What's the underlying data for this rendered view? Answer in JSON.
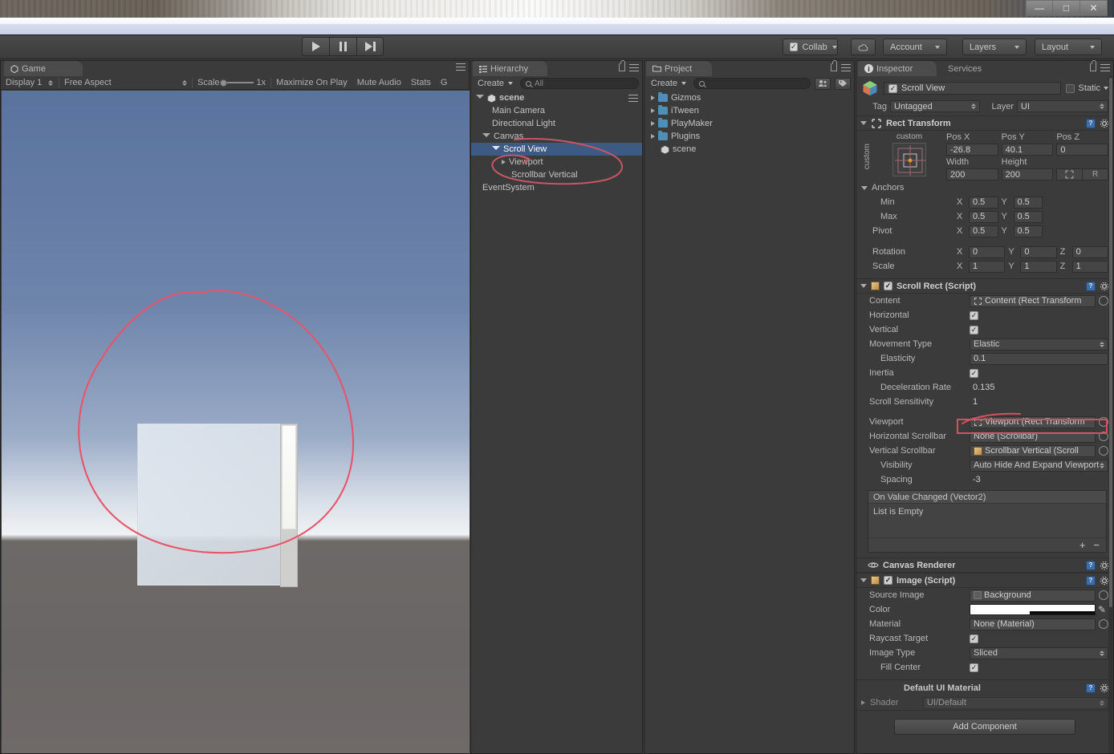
{
  "window": {
    "controls": [
      {
        "name": "minimize",
        "glyph": "—"
      },
      {
        "name": "maximize",
        "glyph": "□"
      },
      {
        "name": "close",
        "glyph": "✕"
      }
    ]
  },
  "toolbar": {
    "collab_label": "Collab",
    "cloud_icon": "cloud-icon",
    "account_label": "Account",
    "layers_label": "Layers",
    "layout_label": "Layout",
    "play_icon": "play-icon",
    "pause_icon": "pause-icon",
    "step_icon": "step-icon"
  },
  "game_panel": {
    "tab_label": "Game",
    "display": "Display 1",
    "aspect": "Free Aspect",
    "scale_label": "Scale",
    "scale_value": "1x",
    "maximize_on_play": "Maximize On Play",
    "mute_audio": "Mute Audio",
    "stats": "Stats",
    "gizmos": "G"
  },
  "hierarchy": {
    "tab_label": "Hierarchy",
    "create_label": "Create",
    "search_placeholder": "All",
    "items": [
      {
        "label": "scene",
        "depth": 0,
        "arrow": "open",
        "icon": "unity-scene-icon",
        "selected": false
      },
      {
        "label": "Main Camera",
        "depth": 1,
        "arrow": "none",
        "icon": "none",
        "selected": false
      },
      {
        "label": "Directional Light",
        "depth": 1,
        "arrow": "none",
        "icon": "none",
        "selected": false
      },
      {
        "label": "Canvas",
        "depth": 1,
        "arrow": "open",
        "icon": "none",
        "selected": false
      },
      {
        "label": "Scroll View",
        "depth": 2,
        "arrow": "open",
        "icon": "none",
        "selected": true
      },
      {
        "label": "Viewport",
        "depth": 3,
        "arrow": "closed",
        "icon": "none",
        "selected": false
      },
      {
        "label": "Scrollbar Vertical",
        "depth": 3,
        "arrow": "none",
        "icon": "none",
        "selected": false
      },
      {
        "label": "EventSystem",
        "depth": 1,
        "arrow": "none",
        "icon": "none",
        "selected": false
      }
    ]
  },
  "project": {
    "tab_label": "Project",
    "create_label": "Create",
    "search_placeholder": "",
    "items": [
      {
        "label": "Gizmos",
        "type": "folder"
      },
      {
        "label": "iTween",
        "type": "folder"
      },
      {
        "label": "PlayMaker",
        "type": "folder"
      },
      {
        "label": "Plugins",
        "type": "folder"
      },
      {
        "label": "scene",
        "type": "scene"
      }
    ]
  },
  "inspector": {
    "tabs": [
      {
        "label": "Inspector",
        "active": true
      },
      {
        "label": "Services",
        "active": false
      }
    ],
    "object_name": "Scroll View",
    "enabled": true,
    "static_label": "Static",
    "static_checked": false,
    "tag_label": "Tag",
    "tag_value": "Untagged",
    "layer_label": "Layer",
    "layer_value": "UI",
    "rect_transform": {
      "title": "Rect Transform",
      "anchor_preset_label": "custom",
      "anchor_preset_side_label": "custom",
      "headers": [
        "Pos X",
        "Pos Y",
        "Pos Z"
      ],
      "pos": [
        "-26.8",
        "40.1",
        "0"
      ],
      "size_headers": [
        "Width",
        "Height"
      ],
      "size": [
        "200",
        "200"
      ],
      "blueprint_btn": "blueprint-icon",
      "raw_btn": "R",
      "anchors_label": "Anchors",
      "min_label": "Min",
      "min": {
        "x": "0.5",
        "y": "0.5"
      },
      "max_label": "Max",
      "max": {
        "x": "0.5",
        "y": "0.5"
      },
      "pivot_label": "Pivot",
      "pivot": {
        "x": "0.5",
        "y": "0.5"
      },
      "rotation_label": "Rotation",
      "rotation": {
        "x": "0",
        "y": "0",
        "z": "0"
      },
      "scale_label": "Scale",
      "scale": {
        "x": "1",
        "y": "1",
        "z": "1"
      }
    },
    "scroll_rect": {
      "title": "Scroll Rect (Script)",
      "enabled": true,
      "content_label": "Content",
      "content_value": "Content (Rect Transform",
      "horizontal_label": "Horizontal",
      "horizontal": true,
      "vertical_label": "Vertical",
      "vertical": true,
      "movement_type_label": "Movement Type",
      "movement_type": "Elastic",
      "elasticity_label": "Elasticity",
      "elasticity": "0.1",
      "inertia_label": "Inertia",
      "inertia": true,
      "deceleration_label": "Deceleration Rate",
      "deceleration": "0.135",
      "scroll_sensitivity_label": "Scroll Sensitivity",
      "scroll_sensitivity": "1",
      "viewport_label": "Viewport",
      "viewport_value": "Viewport (Rect Transform",
      "horizontal_scrollbar_label": "Horizontal Scrollbar",
      "horizontal_scrollbar_value": "None (Scrollbar)",
      "vertical_scrollbar_label": "Vertical Scrollbar",
      "vertical_scrollbar_value": "Scrollbar Vertical (Scroll",
      "visibility_label": "Visibility",
      "visibility_value": "Auto Hide And Expand Viewport",
      "spacing_label": "Spacing",
      "spacing_value": "-3",
      "event_header": "On Value Changed (Vector2)",
      "event_empty": "List is Empty",
      "event_add": "+",
      "event_remove": "−"
    },
    "canvas_renderer": {
      "title": "Canvas Renderer"
    },
    "image": {
      "title": "Image (Script)",
      "enabled": true,
      "source_image_label": "Source Image",
      "source_image_value": "Background",
      "color_label": "Color",
      "color_value": "#FFFFFF",
      "material_label": "Material",
      "material_value": "None (Material)",
      "raycast_target_label": "Raycast Target",
      "raycast_target": true,
      "image_type_label": "Image Type",
      "image_type": "Sliced",
      "fill_center_label": "Fill Center",
      "fill_center": true
    },
    "material": {
      "title": "Default UI Material",
      "shader_label": "Shader",
      "shader_value": "UI/Default"
    },
    "add_component_label": "Add Component"
  },
  "annotations": {
    "color": "#e8556a",
    "marks": [
      {
        "name": "hierarchy-circle",
        "note": "hand drawn loop around Scroll View / Viewport / Scrollbar Vertical"
      },
      {
        "name": "game-view-circle",
        "note": "hand drawn loop around the Scroll View rendered panel"
      },
      {
        "name": "scrollbar-field-box",
        "note": "rectangle around None (Scrollbar) field"
      }
    ]
  }
}
